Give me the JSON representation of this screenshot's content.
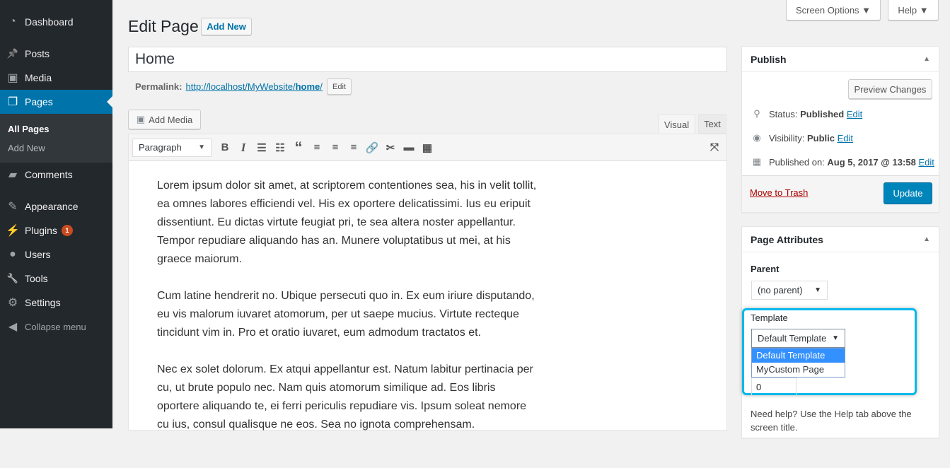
{
  "sidebar": {
    "items": [
      {
        "label": "Dashboard",
        "icon": "dashboard-icon",
        "glyph": "◔"
      },
      {
        "label": "Posts",
        "icon": "pin-icon",
        "glyph": "📌"
      },
      {
        "label": "Media",
        "icon": "media-icon",
        "glyph": "▣"
      },
      {
        "label": "Pages",
        "icon": "pages-icon",
        "glyph": "❐"
      },
      {
        "label": "Comments",
        "icon": "comment-icon",
        "glyph": "▰"
      },
      {
        "label": "Appearance",
        "icon": "brush-icon",
        "glyph": "✎"
      },
      {
        "label": "Plugins",
        "icon": "plugin-icon",
        "glyph": "⚡",
        "badge": "1"
      },
      {
        "label": "Users",
        "icon": "user-icon",
        "glyph": "●"
      },
      {
        "label": "Tools",
        "icon": "wrench-icon",
        "glyph": "🔧"
      },
      {
        "label": "Settings",
        "icon": "settings-icon",
        "glyph": "⚙"
      },
      {
        "label": "Collapse menu",
        "icon": "collapse-icon",
        "glyph": "◀"
      }
    ],
    "submenu": [
      "All Pages",
      "Add New"
    ]
  },
  "header": {
    "screen_options": "Screen Options ▼",
    "help": "Help ▼",
    "title": "Edit Page",
    "add_new": "Add New"
  },
  "editor": {
    "title_value": "Home",
    "permalink_label": "Permalink:",
    "permalink_base": "http://localhost/MyWebsite/",
    "permalink_slug": "home",
    "permalink_trail": "/",
    "edit": "Edit",
    "add_media": "Add Media",
    "tab_visual": "Visual",
    "tab_text": "Text",
    "format": "Paragraph",
    "paragraphs": [
      "Lorem ipsum dolor sit amet, at scriptorem contentiones sea, his in velit tollit, ea omnes labores efficiendi vel. His ex oportere delicatissimi. Ius eu eripuit dissentiunt. Eu dictas virtute feugiat pri, te sea altera noster appellantur. Tempor repudiare aliquando has an. Munere voluptatibus ut mei, at his graece maiorum.",
      "Cum latine hendrerit no. Ubique persecuti quo in. Ex eum iriure disputando, eu vis malorum iuvaret atomorum, per ut saepe mucius. Virtute recteque tincidunt vim in. Pro et oratio iuvaret, eum admodum tractatos et.",
      "Nec ex solet dolorum. Ex atqui appellantur est. Natum labitur pertinacia per cu, ut brute populo nec. Nam quis atomorum similique ad. Eos libris oportere aliquando te, ei ferri periculis repudiare vis. Ipsum soleat nemore cu ius, consul qualisque ne eos. Sea no ignota comprehensam."
    ]
  },
  "publish": {
    "title": "Publish",
    "preview": "Preview Changes",
    "status_label": "Status:",
    "status": "Published",
    "visibility_label": "Visibility:",
    "visibility": "Public",
    "published_label": "Published on:",
    "published": "Aug 5, 2017 @ 13:58",
    "edit": "Edit",
    "trash": "Move to Trash",
    "update": "Update"
  },
  "attributes": {
    "title": "Page Attributes",
    "parent_label": "Parent",
    "parent_value": "(no parent)",
    "template_label": "Template",
    "template_value": "Default Template",
    "template_options": [
      "Default Template",
      "MyCustom Page"
    ],
    "order_value": "0",
    "help": "Need help? Use the Help tab above the screen title."
  },
  "colors": {
    "accent": "#0073aa",
    "highlight": "#00b9eb",
    "selected_option": "#3390ff"
  }
}
